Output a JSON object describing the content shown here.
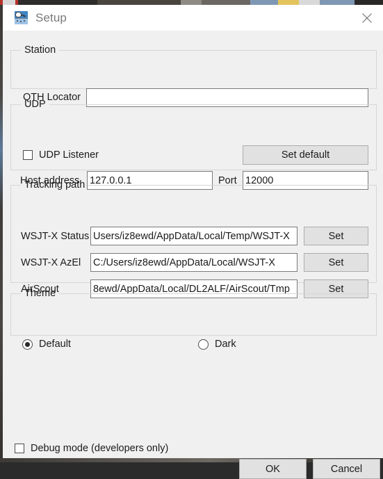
{
  "window": {
    "title": "Setup",
    "icon": "satellite-dish-icon",
    "close_label": "×"
  },
  "station": {
    "legend": "Station",
    "qth_locator": {
      "label": "QTH Locator",
      "value": "",
      "placeholder": ""
    }
  },
  "udp": {
    "legend": "UDP",
    "listener": {
      "label": "UDP Listener",
      "checked": false
    },
    "set_default_label": "Set default",
    "host_address": {
      "label": "Host address",
      "value": "127.0.0.1"
    },
    "port": {
      "label": "Port",
      "value": "12000"
    }
  },
  "tracking": {
    "legend": "Tracking path",
    "rows": [
      {
        "label": "WSJT-X Status",
        "value": "Users/iz8ewd/AppData/Local/Temp/WSJT-X",
        "button": "Set"
      },
      {
        "label": "WSJT-X AzEl",
        "value": "C:/Users/iz8ewd/AppData/Local/WSJT-X",
        "button": "Set"
      },
      {
        "label": "AirScout",
        "value": "8ewd/AppData/Local/DL2ALF/AirScout/Tmp",
        "button": "Set"
      }
    ]
  },
  "theme": {
    "legend": "Theme",
    "options": [
      {
        "label": "Default",
        "selected": true
      },
      {
        "label": "Dark",
        "selected": false
      }
    ]
  },
  "debug": {
    "label": "Debug mode (developers only)",
    "checked": false
  },
  "actions": {
    "ok_label": "OK",
    "cancel_label": "Cancel"
  },
  "colors": {
    "dialog_bg": "#f0f0f0",
    "titlebar_bg": "#ffffff",
    "accent": "#3f85c6",
    "field_border": "#7a7a7a",
    "button_bg": "#e1e1e1"
  }
}
